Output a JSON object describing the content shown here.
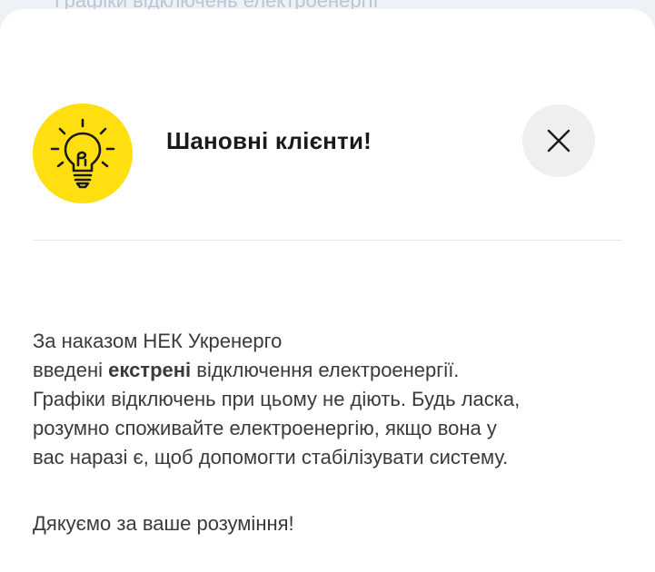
{
  "background": {
    "partial_text": "Графіки відключень електроенергії"
  },
  "modal": {
    "title": "Шановні клієнти!",
    "icon": "lightbulb-icon",
    "close_icon": "close-icon",
    "accent_color": "#ffdf0f",
    "message": {
      "line1": "За наказом НЕК Укренерго",
      "line2_prefix": "введені ",
      "line2_bold": "екстрені",
      "line2_suffix": " відключення електроенергії.",
      "line3": "Графіки відключень при цьому не діють.  Будь ласка,",
      "line4": "розумно споживайте електроенергію, якщо вона у",
      "line5": "вас наразі є, щоб допомогти стабілізувати систему."
    },
    "thanks": "Дякуємо за ваше розуміння!"
  }
}
